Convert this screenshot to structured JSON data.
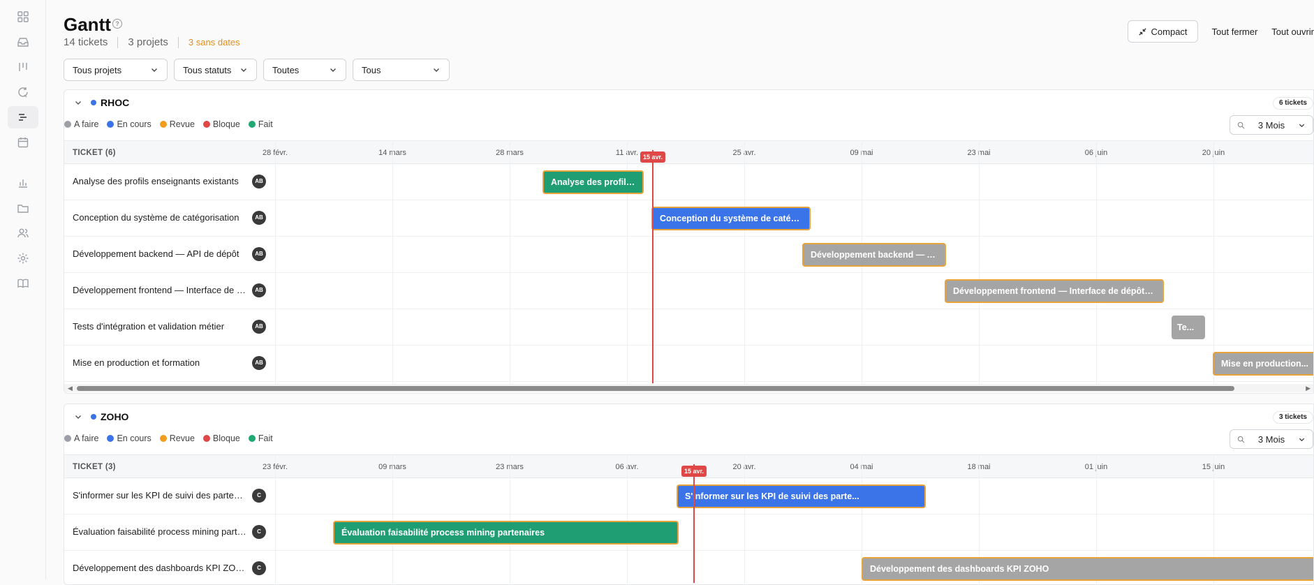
{
  "sidebar": {
    "items": [
      {
        "icon": "grid-icon"
      },
      {
        "icon": "inbox-icon"
      },
      {
        "icon": "columns-icon"
      },
      {
        "icon": "refresh-icon"
      },
      {
        "icon": "gantt-icon",
        "active": true
      },
      {
        "icon": "calendar-icon"
      },
      {
        "icon": "chart-icon"
      },
      {
        "icon": "folder-icon"
      },
      {
        "icon": "users-icon"
      },
      {
        "icon": "settings-icon"
      },
      {
        "icon": "book-icon"
      }
    ]
  },
  "header": {
    "title": "Gantt",
    "tickets": "14 tickets",
    "projects": "3 projets",
    "undated": "3 sans dates",
    "compact_label": "Compact",
    "collapse_all": "Tout fermer",
    "expand_all": "Tout ouvrir"
  },
  "filters": {
    "project": "Tous projets",
    "status": "Tous statuts",
    "third": "Toutes",
    "fourth": "Tous"
  },
  "legend": {
    "todo": "A faire",
    "in_progress": "En cours",
    "review": "Revue",
    "blocked": "Bloque",
    "done": "Fait"
  },
  "colors": {
    "todo": "#9aa0a6",
    "in_progress": "#3b73e8",
    "review": "#f29d1e",
    "blocked": "#e04848",
    "done": "#1fa872"
  },
  "sections": [
    {
      "name": "RHOC",
      "count": "6 tickets",
      "zoom": "3 Mois",
      "ticket_header": "TICKET (6)",
      "dates": [
        "28 févr.",
        "14 mars",
        "28 mars",
        "11 avr.",
        "25 avr.",
        "09 mai",
        "23 mai",
        "06 juin",
        "20 juin"
      ],
      "today": "15 avr.",
      "tickets": [
        {
          "title": "Analyse des profils enseignants existants",
          "assignee": "AB",
          "bar": "Analyse des profils enseignants existants"
        },
        {
          "title": "Conception du système de catégorisation",
          "assignee": "AB",
          "bar": "Conception du système de catégorisation"
        },
        {
          "title": "Développement backend — API de dépôt",
          "assignee": "AB",
          "bar": "Développement backend — API de dépôt"
        },
        {
          "title": "Développement frontend — Interface de dépôt",
          "assignee": "AB",
          "bar": "Développement frontend — Interface de dépôt p..."
        },
        {
          "title": "Tests d'intégration et validation métier",
          "assignee": "AB",
          "bar": "Te..."
        },
        {
          "title": "Mise en production et formation",
          "assignee": "AB",
          "bar": "Mise en production..."
        }
      ]
    },
    {
      "name": "ZOHO",
      "count": "3 tickets",
      "zoom": "3 Mois",
      "ticket_header": "TICKET (3)",
      "dates": [
        "23 févr.",
        "09 mars",
        "23 mars",
        "06 avr.",
        "20 avr.",
        "04 mai",
        "18 mai",
        "01 juin",
        "15 juin"
      ],
      "today": "15 avr.",
      "tickets": [
        {
          "title": "S'informer sur les KPI de suivi des partenaires",
          "assignee": "C",
          "bar": "S'informer sur les KPI de suivi des parte..."
        },
        {
          "title": "Évaluation faisabilité process mining partenaires",
          "assignee": "C",
          "bar": "Évaluation faisabilité process mining partenaires"
        },
        {
          "title": "Développement des dashboards KPI ZOHO",
          "assignee": "C",
          "bar": "Développement des dashboards KPI ZOHO"
        }
      ]
    }
  ]
}
